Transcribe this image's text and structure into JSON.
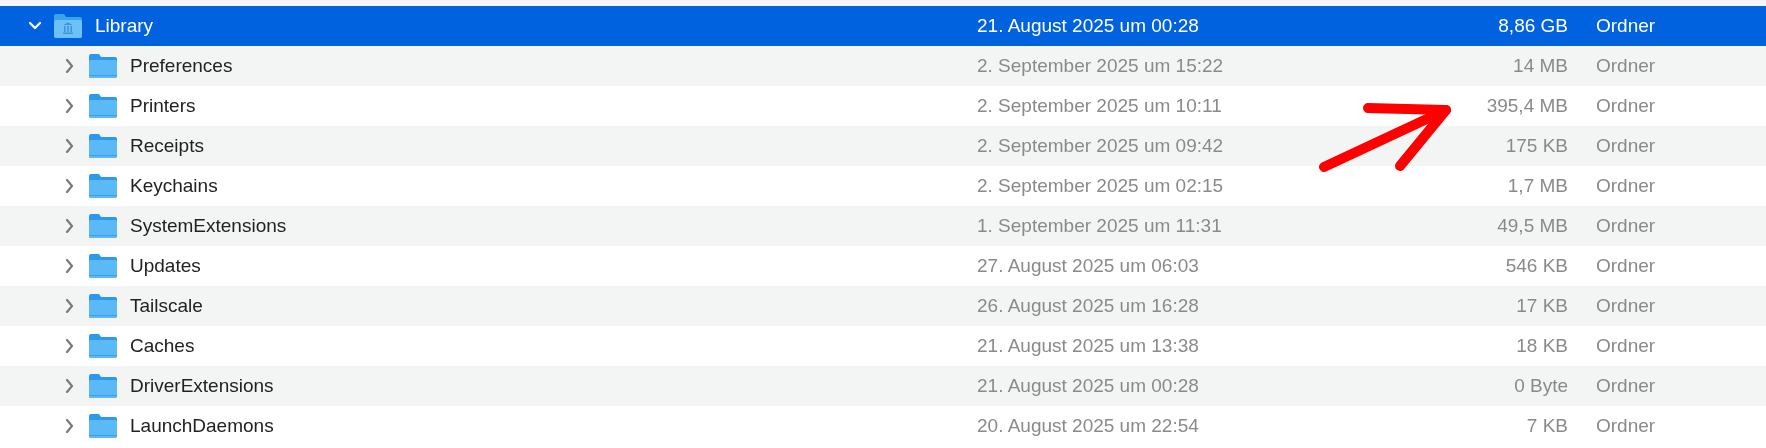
{
  "rows": [
    {
      "name": "Library",
      "date": "21. August 2025 um 00:28",
      "size": "8,86 GB",
      "file_type": "Ordner",
      "kind": "library",
      "expanded": true,
      "selected": true,
      "children": [
        {
          "name": "Preferences",
          "date": "2. September 2025 um 15:22",
          "size": "14 MB",
          "file_type": "Ordner",
          "kind": "folder",
          "expanded": false,
          "selected": false
        },
        {
          "name": "Printers",
          "date": "2. September 2025 um 10:11",
          "size": "395,4 MB",
          "file_type": "Ordner",
          "kind": "folder",
          "expanded": false,
          "selected": false
        },
        {
          "name": "Receipts",
          "date": "2. September 2025 um 09:42",
          "size": "175 KB",
          "file_type": "Ordner",
          "kind": "folder",
          "expanded": false,
          "selected": false
        },
        {
          "name": "Keychains",
          "date": "2. September 2025 um 02:15",
          "size": "1,7 MB",
          "file_type": "Ordner",
          "kind": "folder",
          "expanded": false,
          "selected": false
        },
        {
          "name": "SystemExtensions",
          "date": "1. September 2025 um 11:31",
          "size": "49,5 MB",
          "file_type": "Ordner",
          "kind": "folder",
          "expanded": false,
          "selected": false
        },
        {
          "name": "Updates",
          "date": "27. August 2025 um 06:03",
          "size": "546 KB",
          "file_type": "Ordner",
          "kind": "folder",
          "expanded": false,
          "selected": false
        },
        {
          "name": "Tailscale",
          "date": "26. August 2025 um 16:28",
          "size": "17 KB",
          "file_type": "Ordner",
          "kind": "folder",
          "expanded": false,
          "selected": false
        },
        {
          "name": "Caches",
          "date": "21. August 2025 um 13:38",
          "size": "18 KB",
          "file_type": "Ordner",
          "kind": "folder",
          "expanded": false,
          "selected": false
        },
        {
          "name": "DriverExtensions",
          "date": "21. August 2025 um 00:28",
          "size": "0 Byte",
          "file_type": "Ordner",
          "kind": "folder",
          "expanded": false,
          "selected": false
        },
        {
          "name": "LaunchDaemons",
          "date": "20. August 2025 um 22:54",
          "size": "7 KB",
          "file_type": "Ordner",
          "kind": "folder",
          "expanded": false,
          "selected": false
        }
      ]
    }
  ]
}
